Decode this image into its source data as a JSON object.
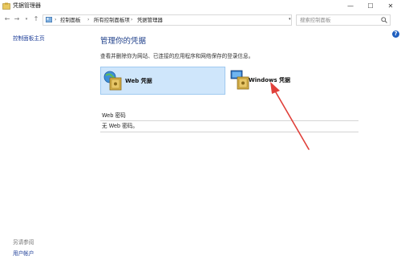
{
  "window": {
    "title": "凭据管理器",
    "minimize": "—",
    "maximize": "☐",
    "close": "✕"
  },
  "address_bar": {
    "crumbs": [
      "控制面板",
      "所有控制面板项",
      "凭据管理器"
    ],
    "separator": "›"
  },
  "search": {
    "placeholder": "搜索控制面板"
  },
  "help": {
    "label": "?"
  },
  "sidebar": {
    "home_link": "控制面板主页",
    "see_also_heading": "另请参阅",
    "user_accounts_link": "用户帐户"
  },
  "main": {
    "title": "管理你的凭据",
    "description": "查看并删除你为网站、已连接的应用程序和网络保存的登录信息。",
    "tiles": [
      {
        "label": "Web 凭据",
        "icon": "web-credentials-safe-icon",
        "selected": true
      },
      {
        "label": "Windows 凭据",
        "icon": "windows-credentials-safe-icon",
        "selected": false
      }
    ],
    "section_header": "Web 密码",
    "empty_note": "无 Web 密码。"
  },
  "colors": {
    "title_blue": "#1e3f8a",
    "link_blue": "#1f3f99",
    "tile_selected_bg": "#cfe6fb",
    "annotation_arrow": "#e0403a"
  }
}
